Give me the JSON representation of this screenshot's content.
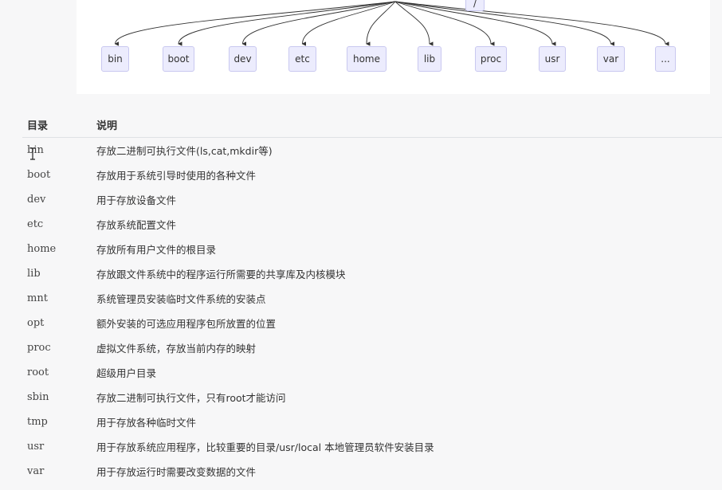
{
  "diagram": {
    "root": "/",
    "children": [
      "bin",
      "boot",
      "dev",
      "etc",
      "home",
      "lib",
      "proc",
      "usr",
      "var",
      "..."
    ]
  },
  "table": {
    "headers": [
      "目录",
      "说明"
    ],
    "rows": [
      {
        "name": "bin",
        "desc": "存放二进制可执行文件(ls,cat,mkdir等)"
      },
      {
        "name": "boot",
        "desc": "存放用于系统引导时使用的各种文件"
      },
      {
        "name": "dev",
        "desc": "用于存放设备文件"
      },
      {
        "name": "etc",
        "desc": "存放系统配置文件"
      },
      {
        "name": "home",
        "desc": "存放所有用户文件的根目录"
      },
      {
        "name": "lib",
        "desc": "存放跟文件系统中的程序运行所需要的共享库及内核模块"
      },
      {
        "name": "mnt",
        "desc": "系统管理员安装临时文件系统的安装点"
      },
      {
        "name": "opt",
        "desc": "额外安装的可选应用程序包所放置的位置"
      },
      {
        "name": "proc",
        "desc": "虚拟文件系统，存放当前内存的映射"
      },
      {
        "name": "root",
        "desc": "超级用户目录"
      },
      {
        "name": "sbin",
        "desc": "存放二进制可执行文件，只有root才能访问"
      },
      {
        "name": "tmp",
        "desc": "用于存放各种临时文件"
      },
      {
        "name": "usr",
        "desc": "用于存放系统应用程序，比较重要的目录/usr/local 本地管理员软件安装目录"
      },
      {
        "name": "var",
        "desc": "用于存放运行时需要改变数据的文件"
      }
    ]
  },
  "colors": {
    "node_fill": "#ececfd",
    "node_border": "#c9c8f0",
    "edge": "#333333"
  }
}
